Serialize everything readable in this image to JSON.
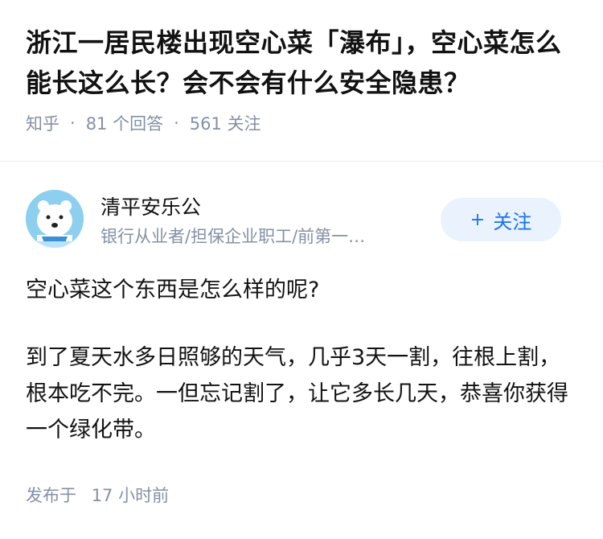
{
  "question": {
    "title": "浙江一居民楼出现空心菜「瀑布」，空心菜怎么能长这么长？会不会有什么安全隐患？",
    "source": "知乎",
    "answers": "81 个回答",
    "followers": "561 关注",
    "separator": "·"
  },
  "author": {
    "name": "清平安乐公",
    "bio": "银行从业者/担保企业职工/前第一…",
    "avatar_icon": "polar-bear-avatar",
    "follow_label": "关注",
    "follow_icon": "+"
  },
  "answer": {
    "paragraphs": [
      "空心菜这个东西是怎么样的呢?",
      "到了夏天水多日照够的天气，几乎3天一割，往根上割，根本吃不完。一但忘记割了，让它多长几天，恭喜你获得一个绿化带。"
    ],
    "published_label": "发布于",
    "published_time": "17 小时前"
  },
  "colors": {
    "text": "#121212",
    "meta": "#8590a6",
    "accent": "#1772f6",
    "follow_bg": "#eaf2fd"
  }
}
